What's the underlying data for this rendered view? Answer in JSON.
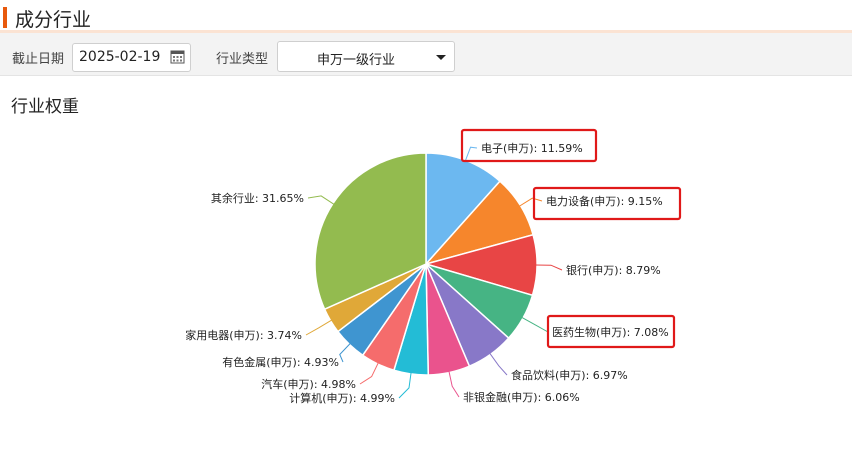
{
  "header": {
    "title": "成分行业"
  },
  "toolbar": {
    "date_label": "截止日期",
    "date_value": "2025-02-19",
    "industry_type_label": "行业类型",
    "industry_type_value": "申万一级行业"
  },
  "panel": {
    "title": "行业权重"
  },
  "chart_data": {
    "type": "pie",
    "slices": [
      {
        "label": "电子(申万): 11.59%",
        "value": 11.59,
        "color": "#6cb8f0",
        "highlighted": true
      },
      {
        "label": "电力设备(申万): 9.15%",
        "value": 9.15,
        "color": "#f6862c",
        "highlighted": true
      },
      {
        "label": "银行(申万): 8.79%",
        "value": 8.79,
        "color": "#e84545",
        "highlighted": false
      },
      {
        "label": "医药生物(申万): 7.08%",
        "value": 7.08,
        "color": "#46b484",
        "highlighted": true
      },
      {
        "label": "食品饮料(申万): 6.97%",
        "value": 6.97,
        "color": "#8878c8",
        "highlighted": false
      },
      {
        "label": "非银金融(申万): 6.06%",
        "value": 6.06,
        "color": "#ea538d",
        "highlighted": false
      },
      {
        "label": "计算机(申万): 4.99%",
        "value": 4.99,
        "color": "#23bcd6",
        "highlighted": false
      },
      {
        "label": "汽车(申万): 4.98%",
        "value": 4.98,
        "color": "#f56c6c",
        "highlighted": false
      },
      {
        "label": "有色金属(申万): 4.93%",
        "value": 4.93,
        "color": "#3f95d0",
        "highlighted": false
      },
      {
        "label": "家用电器(申万): 3.74%",
        "value": 3.74,
        "color": "#e0a838",
        "highlighted": false
      },
      {
        "label": "其余行业: 31.65%",
        "value": 31.65,
        "color": "#93bb4f",
        "highlighted": false
      }
    ]
  }
}
